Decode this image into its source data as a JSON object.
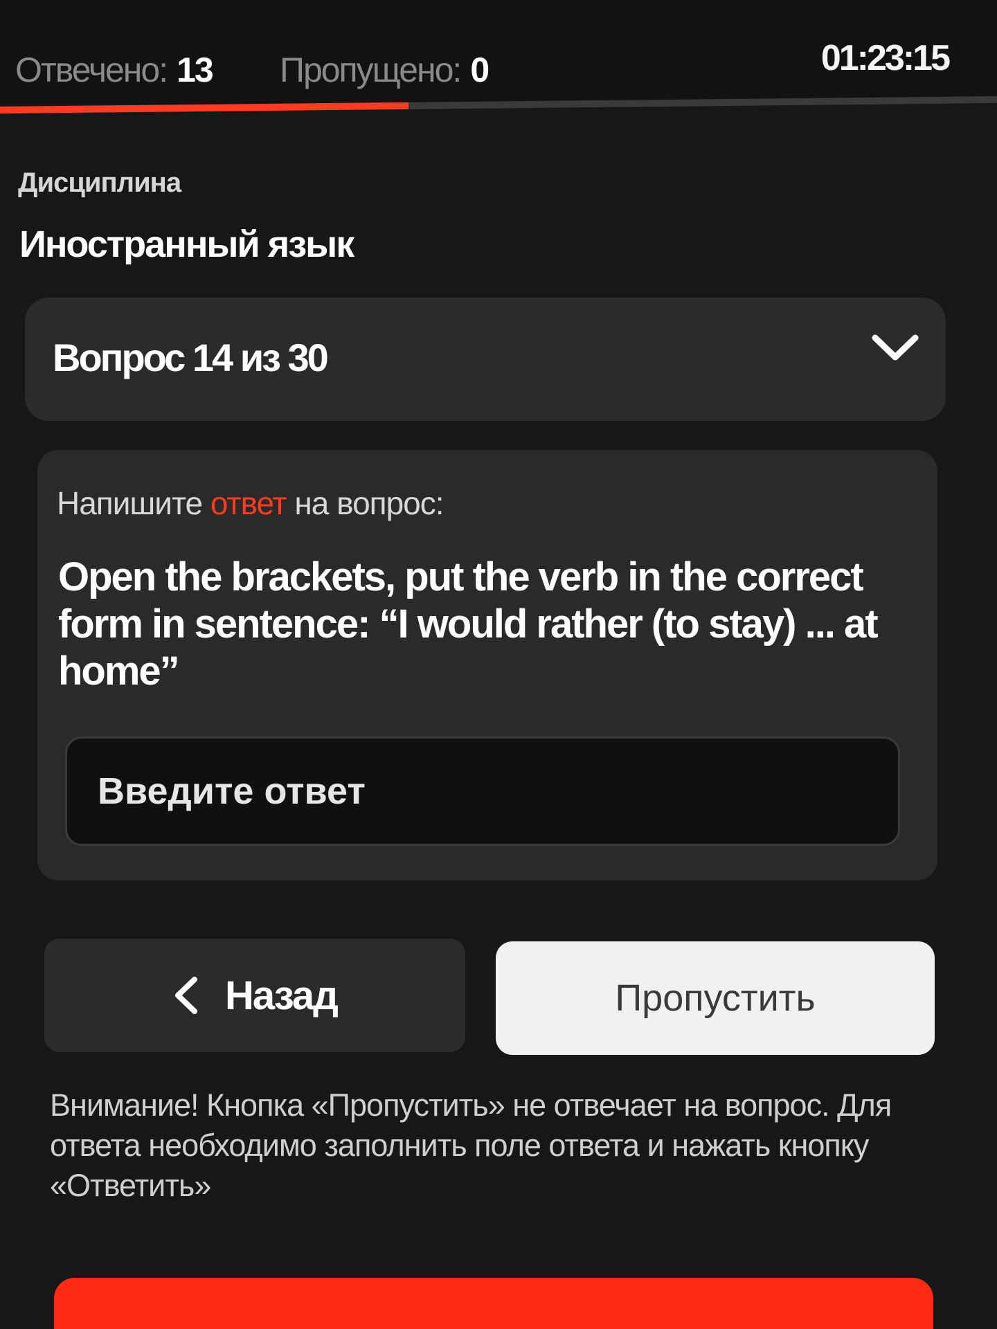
{
  "header": {
    "answered_label": "Отвечено:",
    "answered_count": "13",
    "skipped_label": "Пропущено:",
    "skipped_count": "0",
    "timer": "01:23:15",
    "progress_fraction": 0.41,
    "progress_color": "#ff3b22"
  },
  "discipline": {
    "label": "Дисциплина",
    "name": "Иностранный язык"
  },
  "question_select": {
    "label": "Вопрос 14 из 30",
    "icon": "chevron-down-icon"
  },
  "question": {
    "prompt_before": "Напишите ",
    "prompt_accent": "ответ",
    "prompt_after": " на вопрос:",
    "text": "Open the brackets, put the verb in the correct form in sentence: “I would rather (to stay) ... at home”",
    "input_placeholder": "Введите ответ",
    "input_value": ""
  },
  "actions": {
    "back_label": "Назад",
    "back_icon": "chevron-left-icon",
    "skip_label": "Пропустить"
  },
  "notice": "Внимание! Кнопка «Пропустить» не отвечает на вопрос. Для ответа необходимо заполнить поле ответа и нажать кнопку «Ответить»",
  "colors": {
    "accent": "#ff3b22",
    "background": "#171717",
    "panel": "#2a2a2a"
  }
}
